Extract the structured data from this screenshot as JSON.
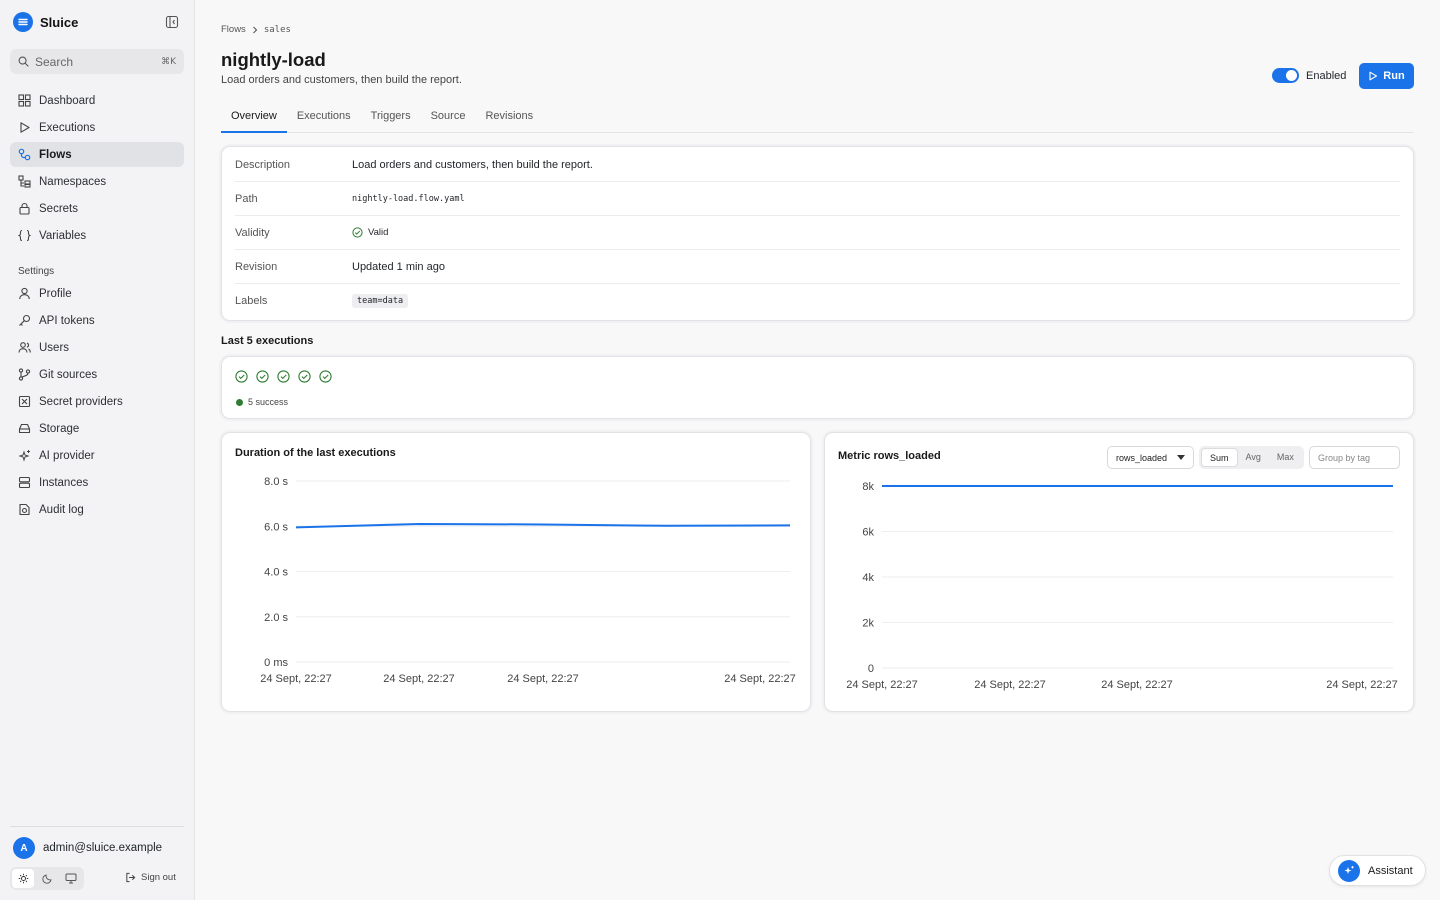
{
  "app": {
    "name": "Sluice"
  },
  "search": {
    "placeholder": "Search",
    "shortcut": "⌘K"
  },
  "sidebar": {
    "items": [
      {
        "label": "Dashboard",
        "icon": "dashboard-icon"
      },
      {
        "label": "Executions",
        "icon": "play-icon"
      },
      {
        "label": "Flows",
        "icon": "flow-icon",
        "active": true
      },
      {
        "label": "Namespaces",
        "icon": "namespace-icon"
      },
      {
        "label": "Secrets",
        "icon": "lock-icon"
      },
      {
        "label": "Variables",
        "icon": "braces-icon"
      }
    ],
    "settings_title": "Settings",
    "settings_items": [
      {
        "label": "Profile",
        "icon": "user-icon"
      },
      {
        "label": "API tokens",
        "icon": "key-icon"
      },
      {
        "label": "Users",
        "icon": "users-icon"
      },
      {
        "label": "Git sources",
        "icon": "git-icon"
      },
      {
        "label": "Secret providers",
        "icon": "secret-provider-icon"
      },
      {
        "label": "Storage",
        "icon": "storage-icon"
      },
      {
        "label": "AI provider",
        "icon": "sparkle-icon"
      },
      {
        "label": "Instances",
        "icon": "server-icon"
      },
      {
        "label": "Audit log",
        "icon": "audit-icon"
      }
    ],
    "user": {
      "initial": "A",
      "email": "admin@sluice.example"
    },
    "signout_label": "Sign out"
  },
  "breadcrumb": {
    "root": "Flows",
    "namespace": "sales"
  },
  "flow": {
    "title": "nightly-load",
    "subtitle": "Load orders and customers, then build the report.",
    "enabled_label": "Enabled",
    "run_label": "Run"
  },
  "tabs": [
    "Overview",
    "Executions",
    "Triggers",
    "Source",
    "Revisions"
  ],
  "details": {
    "description_key": "Description",
    "description_val": "Load orders and customers, then build the report.",
    "path_key": "Path",
    "path_val": "nightly-load.flow.yaml",
    "validity_key": "Validity",
    "validity_val": "Valid",
    "revision_key": "Revision",
    "revision_val": "Updated 1 min ago",
    "labels_key": "Labels",
    "labels_val": "team=data"
  },
  "executions": {
    "title": "Last 5 executions",
    "statuses": [
      "success",
      "success",
      "success",
      "success",
      "success"
    ],
    "legend": "5 success",
    "success_color": "#2e7d32"
  },
  "chart_data": [
    {
      "type": "line",
      "title": "Duration of the last executions",
      "ytick_labels": [
        "0 ms",
        "2.0 s",
        "4.0 s",
        "6.0 s",
        "8.0 s"
      ],
      "ylim": [
        0,
        8
      ],
      "xtick_labels": [
        "24 Sept, 22:27",
        "24 Sept, 22:27",
        "24 Sept, 22:27",
        "24 Sept, 22:27"
      ],
      "series": [
        {
          "values": [
            5.95,
            6.1,
            6.08,
            6.02,
            6.04
          ]
        }
      ],
      "grid": true,
      "color": "#1a73e8"
    },
    {
      "type": "line",
      "title": "Metric rows_loaded",
      "ytick_labels": [
        "0",
        "2k",
        "4k",
        "6k",
        "8k"
      ],
      "ylim": [
        0,
        8000
      ],
      "xtick_labels": [
        "24 Sept, 22:27",
        "24 Sept, 22:27",
        "24 Sept, 22:27",
        "24 Sept, 22:27"
      ],
      "series": [
        {
          "values": [
            8000,
            8000,
            8000,
            8000,
            8000
          ]
        }
      ],
      "grid": true,
      "color": "#1a73e8"
    }
  ],
  "metric_controls": {
    "metric_select": "rows_loaded",
    "aggregations": [
      "Sum",
      "Avg",
      "Max"
    ],
    "active_aggregation": "Sum",
    "group_placeholder": "Group by tag"
  },
  "assistant": {
    "label": "Assistant"
  },
  "colors": {
    "accent": "#1a73e8"
  }
}
